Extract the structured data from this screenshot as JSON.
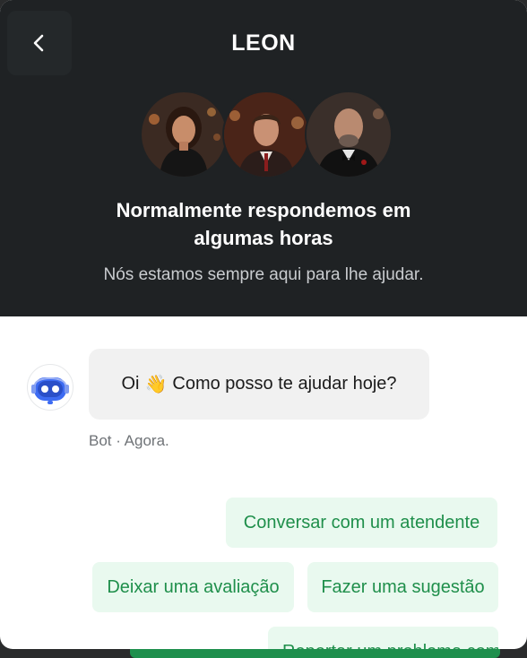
{
  "header": {
    "title": "LEON",
    "headline": "Normalmente respondemos em algumas horas",
    "subtitle": "Nós estamos sempre aqui para lhe ajudar."
  },
  "avatars": [
    "agent-avatar-woman",
    "agent-avatar-man",
    "agent-avatar-bald-man"
  ],
  "chat": {
    "message_before": "Oi",
    "message_emoji": "👋",
    "message_after": "Como posso te ajudar hoje?",
    "meta": "Bot · Agora."
  },
  "options": [
    {
      "label": "Conversar com um atendente"
    },
    {
      "label": "Deixar uma avaliação"
    },
    {
      "label": "Fazer uma sugestão"
    },
    {
      "label": "Reportar um problema com site"
    }
  ],
  "colors": {
    "header_bg": "#1f2224",
    "chip_bg": "#e9f9ef",
    "chip_text": "#1f8f4b",
    "bot_blue": "#3d6bf2",
    "accent_green": "#1e8f4d"
  },
  "icons": {
    "back": "chevron-left-icon",
    "bot": "robot-icon"
  }
}
